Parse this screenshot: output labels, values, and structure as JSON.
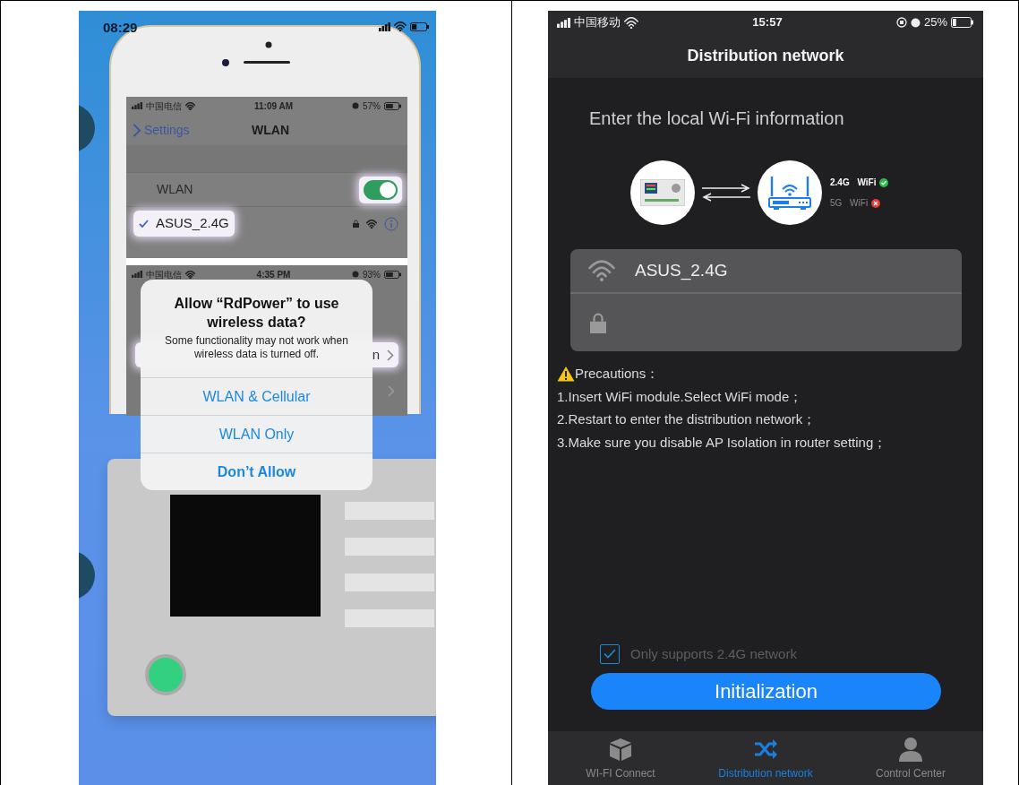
{
  "left_image": {
    "time": "08:29",
    "settings_screen": {
      "status_bar": {
        "carrier": "中国电信",
        "time": "11:09 AM",
        "battery": "57%"
      },
      "back_label": "Settings",
      "title": "WLAN",
      "rows": [
        {
          "kind": "toggle",
          "label": "WLAN",
          "on": true
        },
        {
          "kind": "network",
          "label": "ASUS_2.4G",
          "selected": true
        }
      ]
    },
    "second_screen": {
      "status_bar": {
        "carrier": "中国电信",
        "time": "4:35 PM",
        "battery": "93%"
      },
      "row_label": "n"
    },
    "alert": {
      "title": "Allow “RdPower” to use wireless data?",
      "message": "Some functionality may not work when wireless data is turned off.",
      "actions": [
        {
          "label": "WLAN & Cellular",
          "kind": "default"
        },
        {
          "label": "WLAN Only",
          "kind": "default"
        },
        {
          "label": "Don’t Allow",
          "kind": "preferred"
        }
      ]
    }
  },
  "app": {
    "status_bar": {
      "carrier": "中国移动",
      "time": "15:57",
      "battery": "25%"
    },
    "title": "Distribution network",
    "heading": "Enter the local Wi-Fi information",
    "bands": [
      {
        "label": "2.4G WiFi",
        "supported": true
      },
      {
        "label": "5G WiFi",
        "supported": false
      }
    ],
    "ssid": "ASUS_2.4G",
    "precautions_title": "Precautions：",
    "precautions": [
      "1.Insert WiFi module.Select WiFi mode；",
      "2.Restart to enter the distribution network；",
      "3.Make sure you disable AP Isolation in router setting；"
    ],
    "checkbox": {
      "label": "Only supports 2.4G network",
      "checked": true
    },
    "button": "Initialization",
    "tabs": [
      {
        "label": "WI-FI Connect",
        "kind": "cube",
        "selected": false
      },
      {
        "label": "Distribution network",
        "kind": "shuffle",
        "selected": true
      },
      {
        "label": "Control Center",
        "kind": "person",
        "selected": false
      }
    ]
  }
}
